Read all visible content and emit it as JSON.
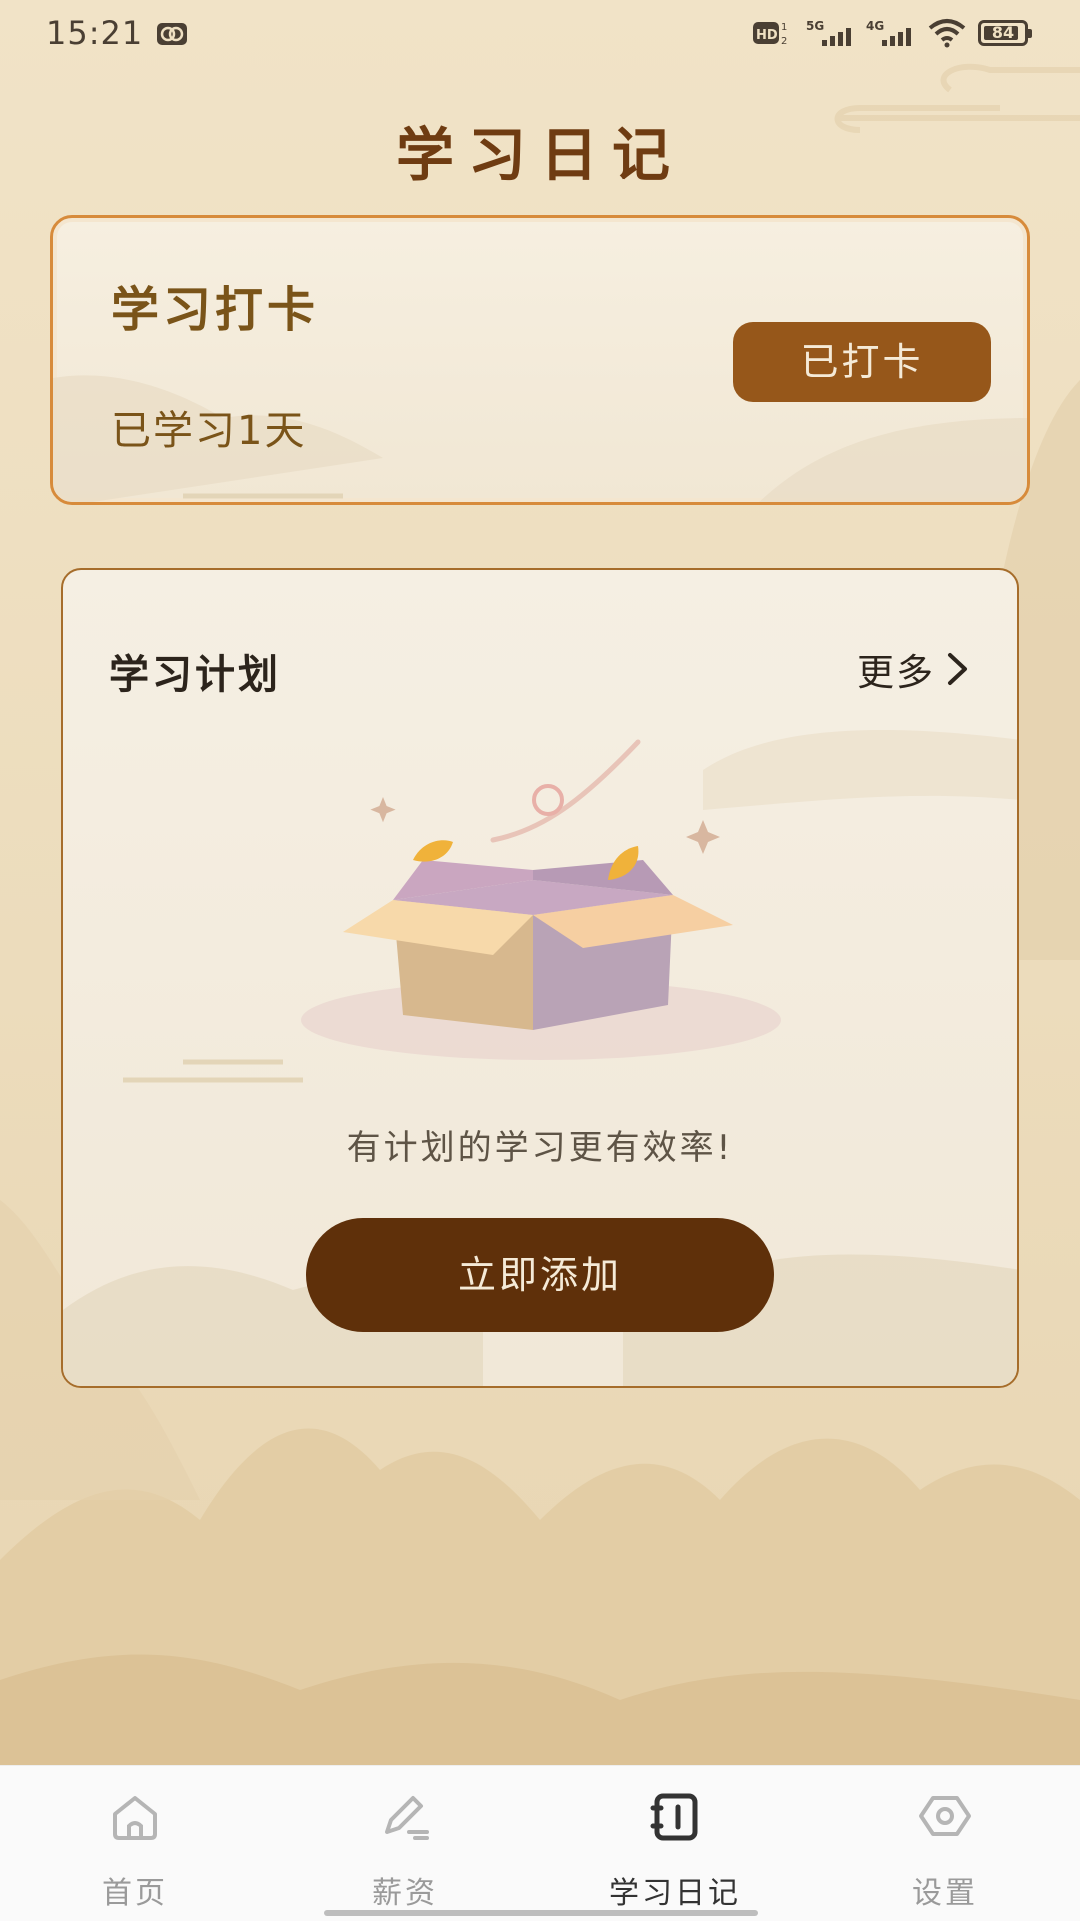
{
  "status_bar": {
    "time": "15:21",
    "battery": "84"
  },
  "page": {
    "title": "学习日记"
  },
  "checkin": {
    "title": "学习打卡",
    "days_text": "已学习1天",
    "button_label": "已打卡"
  },
  "plan": {
    "title": "学习计划",
    "more_label": "更多",
    "empty_text": "有计划的学习更有效率!",
    "add_label": "立即添加"
  },
  "nav": {
    "items": [
      {
        "label": "首页",
        "icon": "home-icon"
      },
      {
        "label": "薪资",
        "icon": "edit-icon"
      },
      {
        "label": "学习日记",
        "icon": "diary-icon"
      },
      {
        "label": "设置",
        "icon": "settings-icon"
      }
    ],
    "active_index": 2
  },
  "colors": {
    "accent": "#96571a",
    "dark_button": "#5f300a",
    "title": "#6f3c12"
  }
}
